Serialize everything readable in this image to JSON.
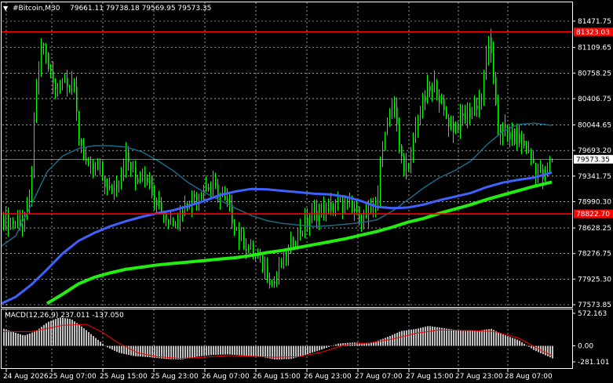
{
  "header": {
    "menu_arrow": "▼",
    "symbol_timeframe": "#Bitcoin,M30",
    "ohlc": "79661.11 79738.18 79569.95 79573.35"
  },
  "price_axis": {
    "ticks": [
      "81471.75",
      "81109.65",
      "80758.25",
      "80406.75",
      "80044.65",
      "79693.20",
      "79341.75",
      "78990.30",
      "78628.25",
      "78276.75",
      "77925.30",
      "77573.85"
    ],
    "tick_values": [
      81471.75,
      81109.65,
      80758.25,
      80406.75,
      80044.65,
      79693.2,
      79341.75,
      78990.3,
      78628.25,
      78276.75,
      77925.3,
      77573.85
    ],
    "current_price_label": "79573.35",
    "current_price": 79573.35
  },
  "levels": [
    {
      "name": "resistance-line",
      "label": "81323.03",
      "value": 81323.03,
      "color": "#ff0000"
    },
    {
      "name": "support-line",
      "label": "78822.70",
      "value": 78822.7,
      "color": "#ff0000"
    }
  ],
  "time_axis": {
    "labels": [
      "24 Aug 2026",
      "25 Aug 07:00",
      "25 Aug 15:00",
      "25 Aug 23:00",
      "26 Aug 07:00",
      "26 Aug 15:00",
      "26 Aug 23:00",
      "27 Aug 07:00",
      "27 Aug 15:00",
      "27 Aug 23:00",
      "28 Aug 07:00"
    ]
  },
  "macd": {
    "label": "MACD(12,26,9) 237.011 -137.050",
    "ticks": [
      "572.163",
      "0.00",
      "-281.101"
    ],
    "tick_values": [
      572.163,
      0,
      -281.101
    ]
  },
  "colors": {
    "background": "#000000",
    "candle": "#00ff00",
    "ma_fast": "#1b6b86",
    "ma_mid": "#3f62ff",
    "ma_slow": "#22ee11",
    "level": "#ff0000",
    "macd_hist": "#c0c0c0",
    "macd_signal": "#ff0000",
    "grid": "#ffffff"
  }
}
